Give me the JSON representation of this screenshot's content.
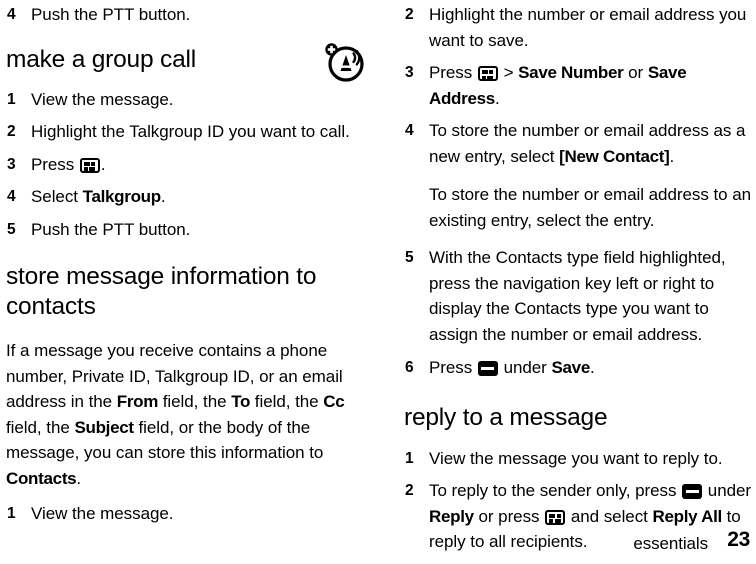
{
  "document": {
    "footer": {
      "chapter": "essentials",
      "page_number": "23"
    },
    "margin_icon": "ptt-talkgroup-icon"
  },
  "icons": {
    "menu_key": "menu-key-icon",
    "soft_key": "soft-key-icon"
  },
  "left_column": {
    "top_step": {
      "number": "4",
      "text": "Push the PTT button."
    },
    "sections": [
      {
        "heading": "make a group call",
        "steps": [
          {
            "number": "1",
            "text": "View the message."
          },
          {
            "number": "2",
            "text": "Highlight the Talkgroup ID you want to call."
          },
          {
            "number": "3",
            "prefix": "Press ",
            "icon": "menu",
            "suffix": "."
          },
          {
            "number": "4",
            "prefix": "Select ",
            "bold": "Talkgroup",
            "suffix": "."
          },
          {
            "number": "5",
            "text": "Push the PTT button."
          }
        ]
      },
      {
        "heading": "store message information to contacts",
        "intro": {
          "part1": "If a message you receive contains a phone number, Private ID, Talkgroup ID, or an email address in the ",
          "bold1": "From",
          "part2": " field, the ",
          "bold2": "To",
          "part3": " field, the ",
          "bold3": "Cc",
          "part4": " field, the ",
          "bold4": "Subject",
          "part5": " field, or the body of the message, you can store this information to ",
          "bold5": "Contacts",
          "part6": "."
        },
        "steps": [
          {
            "number": "1",
            "text": "View the message."
          }
        ]
      }
    ]
  },
  "right_column": {
    "continued_steps": [
      {
        "number": "2",
        "text": "Highlight the number or email address you want to save."
      },
      {
        "number": "3",
        "prefix": "Press ",
        "icon": "menu",
        "mid": " > ",
        "bold1": "Save Number",
        "mid2": " or ",
        "bold2": "Save Address",
        "suffix": "."
      },
      {
        "number": "4",
        "prefix": "To store the number or email address as a new entry, select ",
        "bold1": "[New Contact]",
        "suffix": ".",
        "followup": "To store the number or email address to an existing entry, select the entry."
      },
      {
        "number": "5",
        "text": "With the Contacts type field highlighted, press the navigation key left or right to display the Contacts type you want to assign the number or email address."
      },
      {
        "number": "6",
        "prefix": "Press ",
        "icon": "soft",
        "mid": " under ",
        "bold1": "Save",
        "suffix": "."
      }
    ],
    "sections": [
      {
        "heading": "reply to a message",
        "steps": [
          {
            "number": "1",
            "text": "View the message you want to reply to."
          },
          {
            "number": "2",
            "prefix": "To reply to the sender only, press ",
            "icon1": "soft",
            "mid1": " under ",
            "bold1": "Reply",
            "mid2": " or press ",
            "icon2": "menu",
            "mid3": " and select ",
            "bold2": "Reply All",
            "suffix": " to reply to all recipients."
          }
        ]
      }
    ]
  }
}
